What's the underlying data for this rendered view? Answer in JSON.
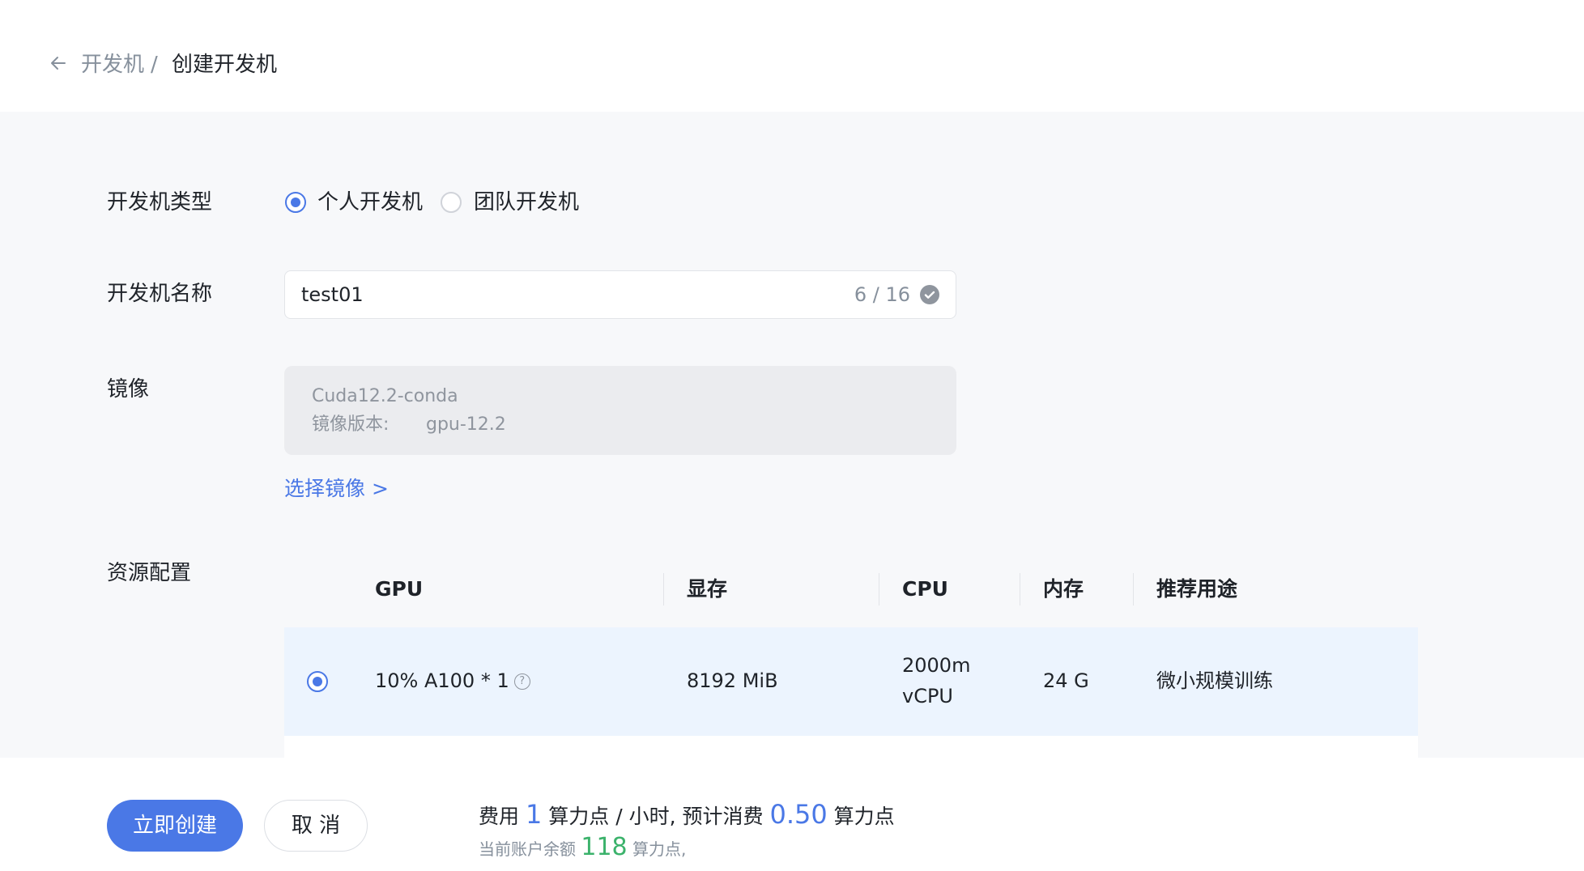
{
  "breadcrumb": {
    "back_icon": "arrow-left-icon",
    "parent": "开发机",
    "separator": "/",
    "current": "创建开发机"
  },
  "form": {
    "type_label": "开发机类型",
    "type_options": [
      {
        "label": "个人开发机",
        "checked": true
      },
      {
        "label": "团队开发机",
        "checked": false
      }
    ],
    "name_label": "开发机名称",
    "name_value": "test01",
    "name_count": "6 / 16",
    "image_label": "镜像",
    "image_name": "Cuda12.2-conda",
    "image_version_label": "镜像版本:",
    "image_version_value": "gpu-12.2",
    "select_image_link": "选择镜像 >",
    "resource_label": "资源配置"
  },
  "resource_table": {
    "headers": [
      "GPU",
      "显存",
      "CPU",
      "内存",
      "推荐用途"
    ],
    "rows": [
      {
        "selected": true,
        "gpu": "10% A100 * 1",
        "vram": "8192 MiB",
        "cpu_line1": "2000m",
        "cpu_line2": "vCPU",
        "memory": "24 G",
        "usage": "微小规模训练"
      }
    ]
  },
  "footer": {
    "create_button": "立即创建",
    "cancel_button": "取 消",
    "fee_prefix": "费用",
    "fee_rate": "1",
    "fee_rate_unit": "算力点 / 小时, 预计消费",
    "fee_estimate": "0.50",
    "fee_estimate_unit": "算力点",
    "balance_prefix": "当前账户余额",
    "balance_value": "118",
    "balance_unit": "算力点,"
  },
  "colors": {
    "accent": "#4a78e6",
    "balance": "#3bb26b",
    "selected_row": "#ecf4fe"
  }
}
